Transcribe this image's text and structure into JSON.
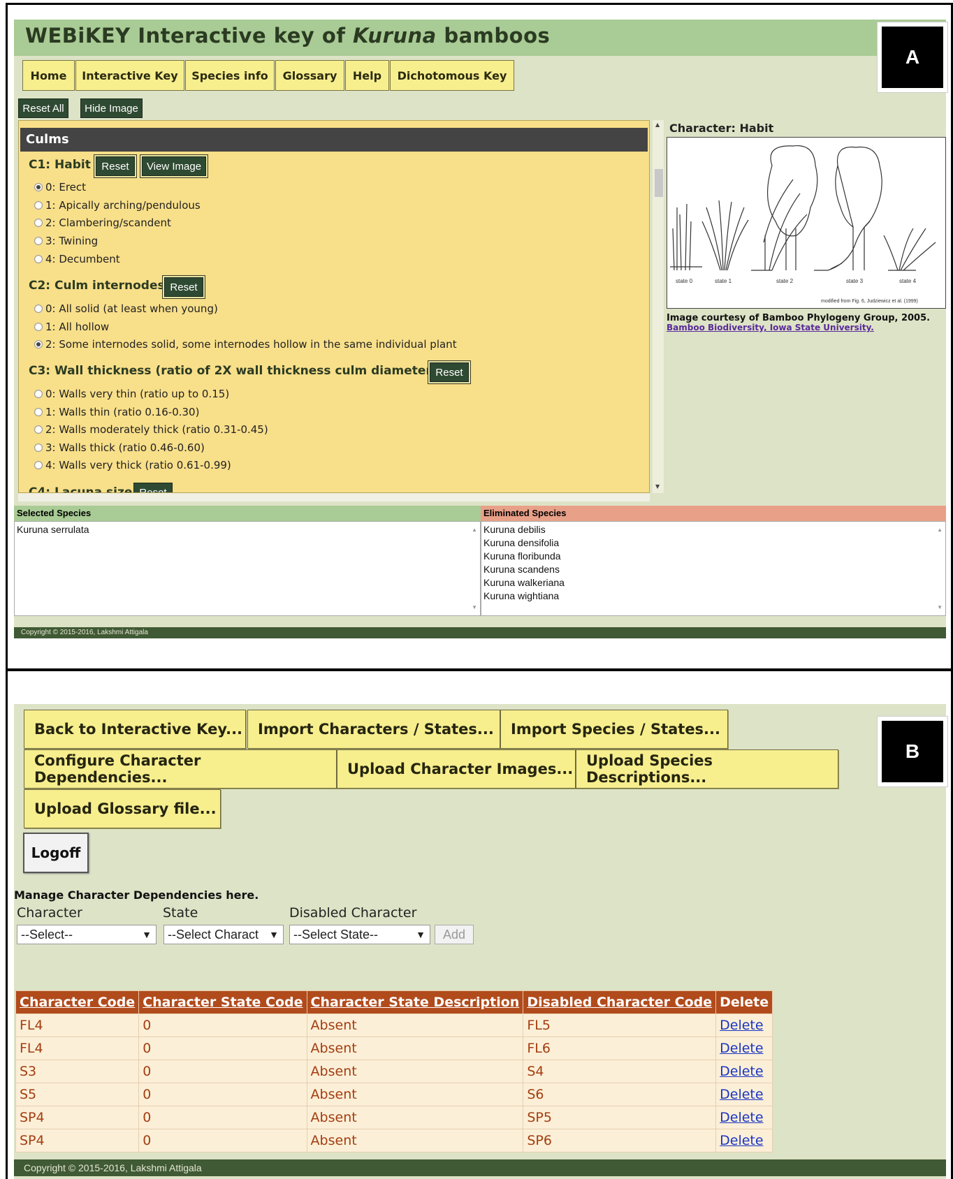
{
  "panel_a": {
    "label": "A",
    "title_prefix": "WEBiKEY Interactive key of ",
    "title_italic": "Kuruna",
    "title_suffix": " bamboos",
    "nav": [
      "Home",
      "Interactive Key",
      "Species info",
      "Glossary",
      "Help",
      "Dichotomous Key"
    ],
    "reset_all": "Reset All",
    "hide_image": "Hide Image",
    "section": "Culms",
    "reset_label": "Reset",
    "view_image_label": "View Image",
    "characters": [
      {
        "title": "C1: Habit",
        "options": [
          "0: Erect",
          "1: Apically arching/pendulous",
          "2: Clambering/scandent",
          "3: Twining",
          "4: Decumbent"
        ],
        "selected": 0
      },
      {
        "title": "C2: Culm internodes",
        "options": [
          "0: All solid (at least when young)",
          "1: All hollow",
          "2: Some internodes solid, some internodes hollow in the same individual plant"
        ],
        "selected": 2
      },
      {
        "title": "C3: Wall thickness (ratio of 2X wall thickness culm diameter)",
        "options": [
          "0: Walls very thin (ratio up to 0.15)",
          "1: Walls thin (ratio 0.16-0.30)",
          "2: Walls moderately thick (ratio 0.31-0.45)",
          "3: Walls thick (ratio 0.46-0.60)",
          "4: Walls very thick (ratio 0.61-0.99)"
        ],
        "selected": -1
      },
      {
        "title": "C4: Lacuna size"
      }
    ],
    "image_panel": {
      "heading": "Character: Habit",
      "state_labels": [
        "state 0",
        "state 1",
        "state 2",
        "state 3",
        "state 4"
      ],
      "figure_note": "modified from Fig. 6, Judziewicz et al. (1999)",
      "courtesy": "Image courtesy of Bamboo Phylogeny Group, 2005.",
      "link": "Bamboo Biodiversity, Iowa State University."
    },
    "selected_species_heading": "Selected Species",
    "selected_species": [
      "Kuruna serrulata"
    ],
    "eliminated_species_heading": "Eliminated Species",
    "eliminated_species": [
      "Kuruna debilis",
      "Kuruna densifolia",
      "Kuruna floribunda",
      "Kuruna scandens",
      "Kuruna walkeriana",
      "Kuruna wightiana"
    ],
    "copyright": "Copyright © 2015-2016, Lakshmi Attigala",
    "colors": {
      "header": "#a9cb95",
      "panel": "#dde3c6",
      "button_yellow": "#f7ee8e",
      "char_bg": "#f8df8a",
      "selected_head": "#a9cb95",
      "eliminated_head": "#e9a088"
    }
  },
  "panel_b": {
    "label": "B",
    "buttons": [
      "Back to Interactive Key...",
      "Import Characters / States...",
      "Import Species / States...",
      "Configure Character Dependencies...",
      "Upload Character Images...",
      "Upload Species Descriptions...",
      "Upload Glossary file..."
    ],
    "logoff": "Logoff",
    "manage_text": "Manage Character Dependencies here.",
    "form_labels": {
      "character": "Character",
      "state": "State",
      "disabled": "Disabled Character"
    },
    "selects": {
      "character": "--Select--",
      "state": "--Select Charact",
      "disabled": "--Select State--"
    },
    "add_label": "Add",
    "table": {
      "headers": [
        "Character Code",
        "Character State Code",
        "Character State Description",
        "Disabled Character Code",
        "Delete"
      ],
      "rows": [
        [
          "FL4",
          "0",
          "Absent",
          "FL5",
          "Delete"
        ],
        [
          "FL4",
          "0",
          "Absent",
          "FL6",
          "Delete"
        ],
        [
          "S3",
          "0",
          "Absent",
          "S4",
          "Delete"
        ],
        [
          "S5",
          "0",
          "Absent",
          "S6",
          "Delete"
        ],
        [
          "SP4",
          "0",
          "Absent",
          "SP5",
          "Delete"
        ],
        [
          "SP4",
          "0",
          "Absent",
          "SP6",
          "Delete"
        ]
      ]
    },
    "copyright": "Copyright © 2015-2016, Lakshmi Attigala",
    "colors": {
      "table_head": "#b14b1c",
      "table_cell": "#fcefd8",
      "link": "#1a35c2"
    }
  }
}
